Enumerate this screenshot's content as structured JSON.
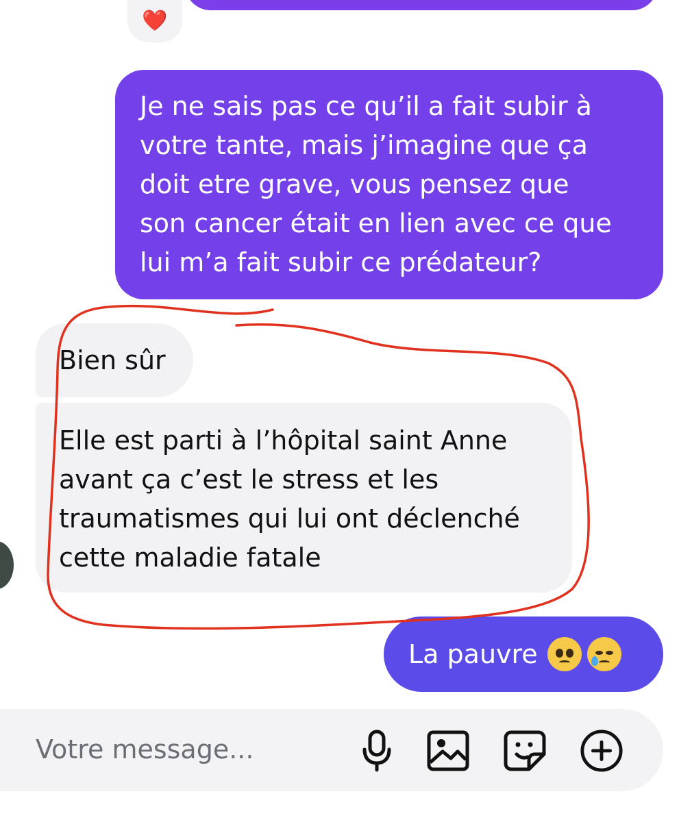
{
  "conversation": {
    "messages": [
      {
        "direction": "sent",
        "lines": [
          "Je ne sais pas ce qu’il a fait subir à",
          "votre tante, mais j’imagine que ça",
          "doit etre grave, vous pensez que",
          "son cancer était en lien avec ce que",
          "lui m’a fait subir ce prédateur?"
        ]
      },
      {
        "direction": "received",
        "text": "Bien sûr"
      },
      {
        "direction": "received",
        "lines": [
          "Elle est parti à l’hôpital saint Anne",
          "avant ça c’est le stress et les",
          "traumatismes qui lui ont déclenché",
          "cette maladie fatale"
        ]
      },
      {
        "direction": "sent",
        "text": "La pauvre",
        "emojis": [
          "pleading-face-icon",
          "crying-face-icon"
        ]
      }
    ],
    "reaction": "❤️"
  },
  "composer": {
    "placeholder": "Votre message...",
    "tools": [
      "microphone-icon",
      "image-icon",
      "sticker-icon",
      "plus-circle-icon"
    ]
  },
  "colors": {
    "sent_bubble": "#7440ea",
    "sent_bubble_alt": "#5b4cea",
    "received_bubble": "#f2f2f4",
    "annotation_stroke": "#e0301e"
  }
}
